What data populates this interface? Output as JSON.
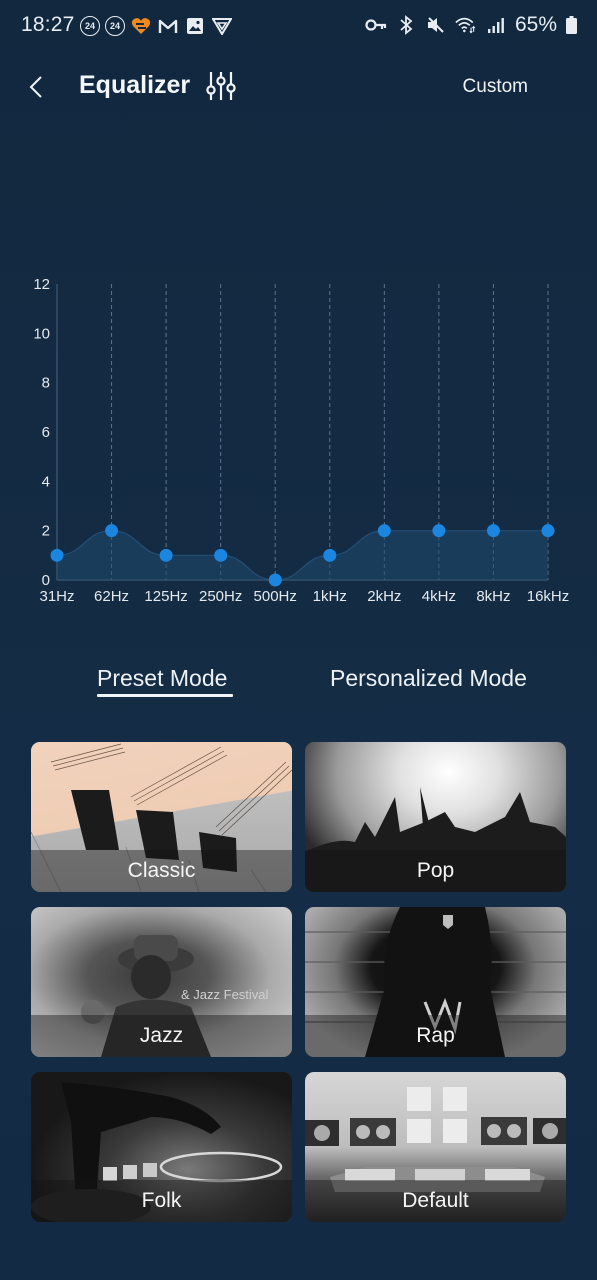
{
  "status_bar": {
    "time": "18:27",
    "left_icons": [
      {
        "name": "notification-24-icon",
        "text": "24"
      },
      {
        "name": "notification-24-icon",
        "text": "24"
      },
      {
        "name": "orange-app-icon"
      },
      {
        "name": "gmail-icon"
      },
      {
        "name": "gallery-icon"
      },
      {
        "name": "vpn-shield-icon"
      }
    ],
    "right_icons": [
      "key-icon",
      "bluetooth-icon",
      "mute-icon",
      "wifi-icon",
      "signal-icon"
    ],
    "battery_percent": "65%"
  },
  "header": {
    "title": "Equalizer",
    "custom_label": "Custom"
  },
  "chart_data": {
    "type": "area",
    "title": "",
    "xlabel": "",
    "ylabel": "",
    "categories": [
      "31Hz",
      "62Hz",
      "125Hz",
      "250Hz",
      "500Hz",
      "1kHz",
      "2kHz",
      "4kHz",
      "8kHz",
      "16kHz"
    ],
    "values": [
      1,
      2,
      1,
      1,
      0,
      1,
      2,
      2,
      2,
      2
    ],
    "ylim": [
      0,
      12
    ],
    "yticks": [
      0,
      2,
      4,
      6,
      8,
      10,
      12
    ],
    "grid": "vertical-dashed",
    "colors": {
      "point": "#1a86e0",
      "fill": "#1f4a70",
      "grid": "#5b7590",
      "axis": "#4a6580"
    }
  },
  "mode_tabs": {
    "preset": "Preset Mode",
    "personalized": "Personalized Mode",
    "active": "preset"
  },
  "presets": [
    {
      "label": "Classic",
      "art": "classic"
    },
    {
      "label": "Pop",
      "art": "pop"
    },
    {
      "label": "Jazz",
      "art": "jazz"
    },
    {
      "label": "Rap",
      "art": "rap"
    },
    {
      "label": "Folk",
      "art": "folk"
    },
    {
      "label": "Default",
      "art": "default"
    }
  ]
}
